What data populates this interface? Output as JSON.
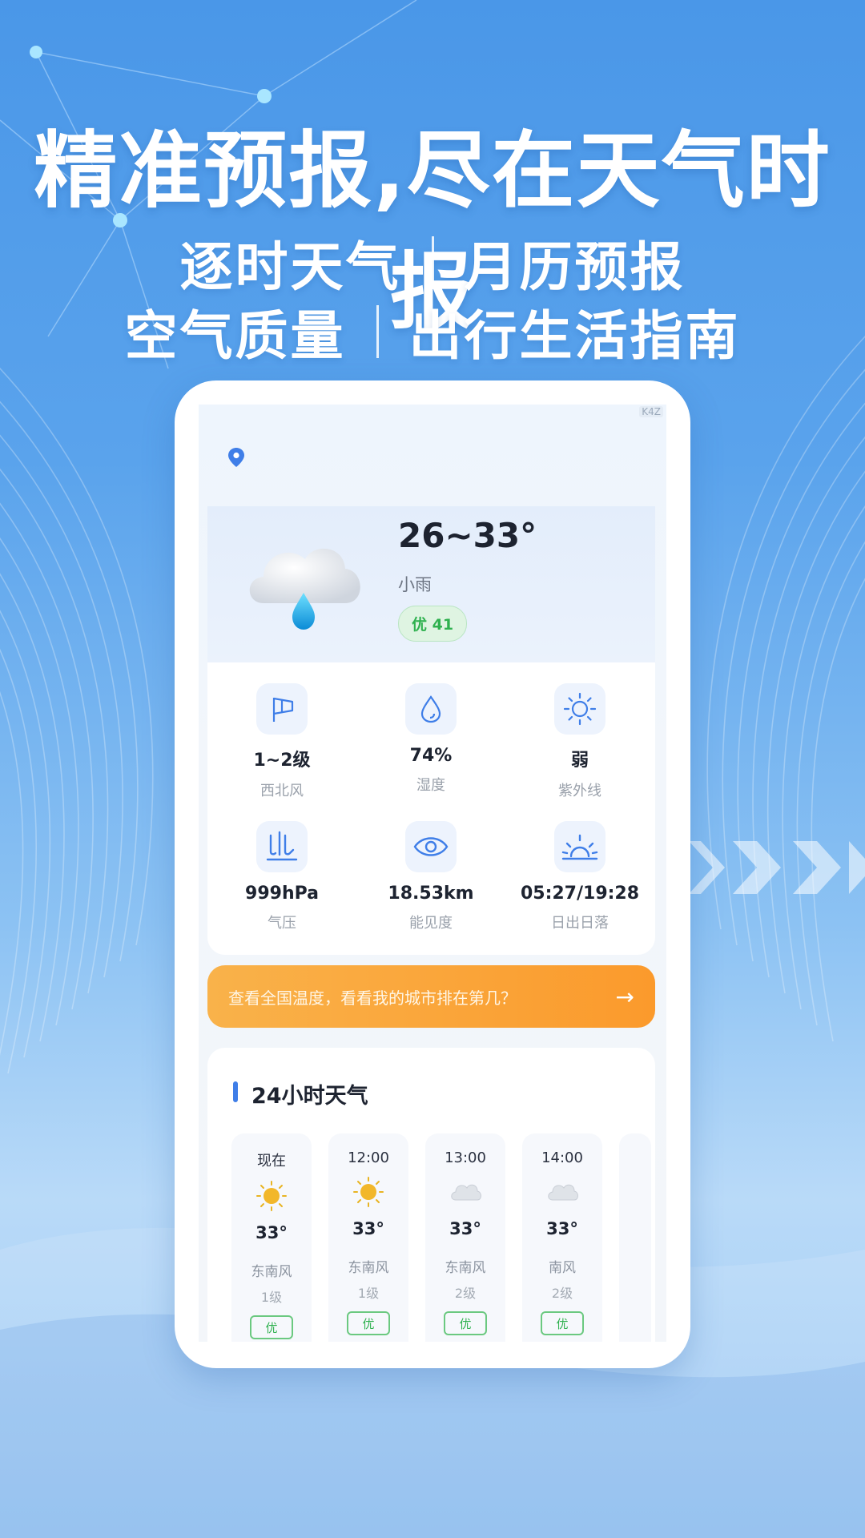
{
  "promo": {
    "headline": "精准预报,尽在天气时报",
    "line1": [
      "逐时天气",
      "月历预报"
    ],
    "line2": [
      "空气质量",
      "出行生活指南"
    ]
  },
  "app": {
    "status_tag": "K4Z",
    "today": {
      "temp_range": "26~33°",
      "condition": "小雨",
      "aqi": "优 41",
      "icon": "cloud-rain-icon"
    },
    "metrics": [
      {
        "value": "1~2级",
        "label": "西北风",
        "icon": "flag-icon"
      },
      {
        "value": "74%",
        "label": "湿度",
        "icon": "drop-icon"
      },
      {
        "value": "弱",
        "label": "紫外线",
        "icon": "sun-icon"
      },
      {
        "value": "999hPa",
        "label": "气压",
        "icon": "pressure-icon"
      },
      {
        "value": "18.53km",
        "label": "能见度",
        "icon": "eye-icon"
      },
      {
        "value": "05:27/19:28",
        "label": "日出日落",
        "icon": "sunrise-icon"
      }
    ],
    "banner": {
      "text": "查看全国温度，看看我的城市排在第几？",
      "arrow": "→"
    },
    "hourly": {
      "title": "24小时天气",
      "items": [
        {
          "time": "现在",
          "temp": "33°",
          "wind": "东南风",
          "level": "1级",
          "quality": "优",
          "icon": "sun-icon"
        },
        {
          "time": "12:00",
          "temp": "33°",
          "wind": "东南风",
          "level": "1级",
          "quality": "优",
          "icon": "sun-icon"
        },
        {
          "time": "13:00",
          "temp": "33°",
          "wind": "东南风",
          "level": "2级",
          "quality": "优",
          "icon": "cloud-icon"
        },
        {
          "time": "14:00",
          "temp": "33°",
          "wind": "南风",
          "level": "2级",
          "quality": "优",
          "icon": "cloud-icon"
        }
      ]
    }
  },
  "colors": {
    "accent": "#3f7ee8",
    "good": "#2fb14f",
    "banner": "#fb9a2c"
  }
}
